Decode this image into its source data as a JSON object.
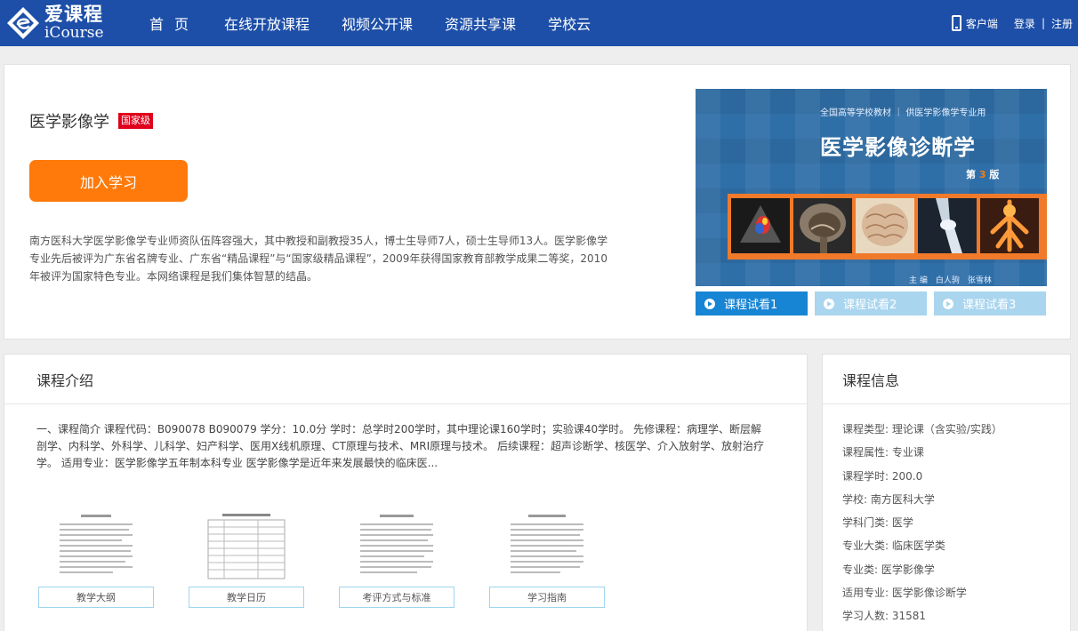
{
  "header": {
    "logo": {
      "cn": "爱课程",
      "en": "iCourse"
    },
    "nav": [
      "首页",
      "在线开放课程",
      "视频公开课",
      "资源共享课",
      "学校云"
    ],
    "client_label": "客户端",
    "login_label": "登录",
    "separator": "|",
    "register_label": "注册"
  },
  "course": {
    "title": "医学影像学",
    "badge": "国家级",
    "join_label": "加入学习",
    "description": "南方医科大学医学影像学专业师资队伍阵容强大，其中教授和副教授35人，博士生导师7人，硕士生导师13人。医学影像学专业先后被评为广东省名牌专业、广东省“精品课程”与“国家级精品课程”，2009年获得国家教育部教学成果二等奖，2010年被评为国家特色专业。本网络课程是我们集体智慧的结晶。",
    "cover": {
      "subtitle": "全国高等学校教材 ｜ 供医学影像学专业用",
      "title": "医学影像诊断学",
      "edition_prefix": "第",
      "edition_num": "3",
      "edition_suffix": "版",
      "authors": "主 编　白人驹　张雪林"
    },
    "previews": [
      "课程试看1",
      "课程试看2",
      "课程试看3"
    ]
  },
  "intro": {
    "heading": "课程介绍",
    "text": "一、课程简介 课程代码：B090078 B090079 学分：10.0分 学时：总学时200学时，其中理论课160学时；实验课40学时。 先修课程：病理学、断层解剖学、内科学、外科学、儿科学、妇产科学、医用X线机原理、CT原理与技术、MRI原理与技术。 后续课程：超声诊断学、核医学、介入放射学、放射治疗学。 适用专业：医学影像学五年制本科专业 医学影像学是近年来发展最快的临床医...",
    "docs": [
      "教学大纲",
      "教学日历",
      "考评方式与标准",
      "学习指南"
    ]
  },
  "info": {
    "heading": "课程信息",
    "rows": [
      "课程类型: 理论课（含实验/实践）",
      "课程属性: 专业课",
      "课程学时: 200.0",
      "学校: 南方医科大学",
      "学科门类: 医学",
      "专业大类: 临床医学类",
      "专业类: 医学影像学",
      "适用专业: 医学影像诊断学",
      "学习人数: 31581"
    ]
  },
  "colors": {
    "header_bg": "#1d4fa8",
    "accent_orange": "#ff7a0a",
    "badge_red": "#e0001b",
    "preview_active": "#1784d4",
    "preview_inactive": "#a9d5ef"
  }
}
